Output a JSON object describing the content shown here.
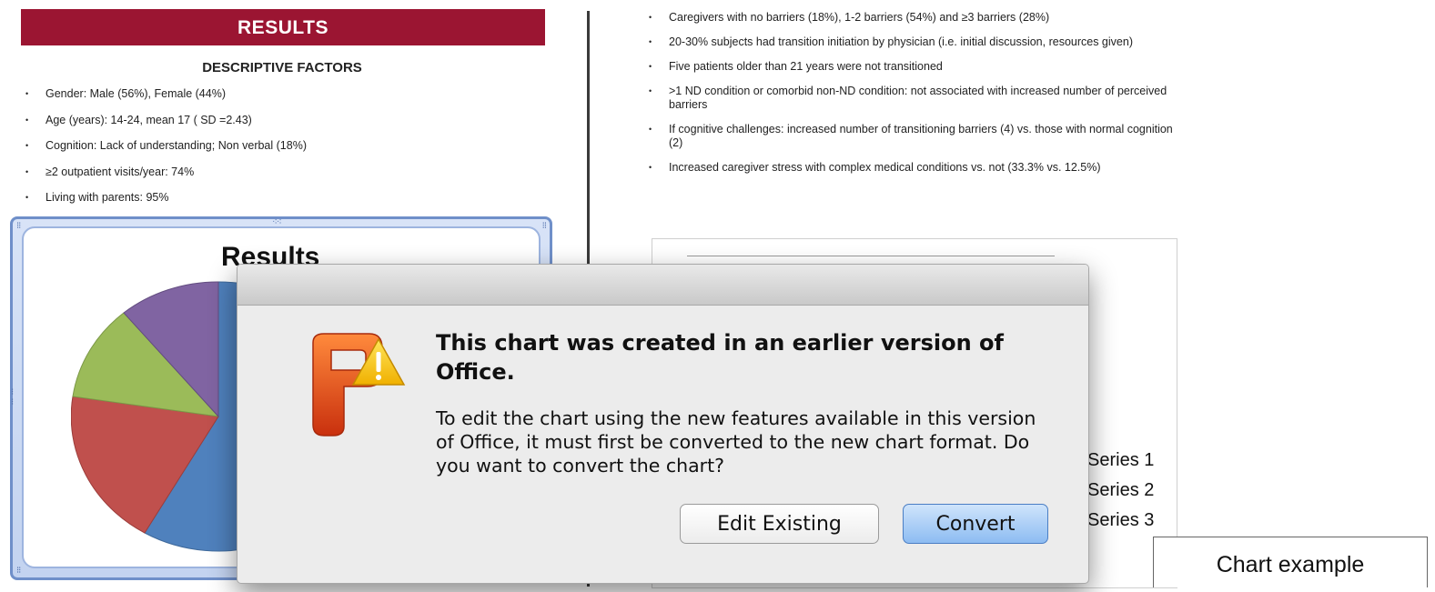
{
  "left": {
    "banner": "RESULTS",
    "subhead": "DESCRIPTIVE FACTORS",
    "bullets": [
      "Gender: Male (56%), Female (44%)",
      "Age (years): 14-24, mean 17 ( SD =2.43)",
      "Cognition: Lack of understanding; Non verbal (18%)",
      "≥2 outpatient visits/year: 74%",
      "Living with parents: 95%"
    ],
    "chart": {
      "title": "Results"
    }
  },
  "right": {
    "bullets": [
      "Caregivers with no barriers (18%), 1-2 barriers (54%) and ≥3 barriers (28%)",
      "20-30% subjects had transition initiation by physician (i.e. initial discussion, resources given)",
      "Five patients older than 21 years were not transitioned",
      ">1 ND condition or comorbid non-ND condition: not associated with increased number of perceived barriers",
      "If cognitive challenges: increased number of transitioning barriers (4) vs. those with normal cognition (2)",
      "Increased caregiver stress with complex medical conditions vs. not (33.3% vs. 12.5%)"
    ],
    "legend": [
      "Series 1",
      "Series 2",
      "Series 3"
    ],
    "caption": "Chart example"
  },
  "dialog": {
    "heading": "This chart was created in an earlier version of Office.",
    "body": "To edit the chart using the new features available in this version of Office, it must first be converted to the new chart format. Do you want to convert the chart?",
    "edit_label": "Edit Existing",
    "convert_label": "Convert"
  },
  "colors": {
    "banner": "#9b1532",
    "accent": "#4a7ec4"
  },
  "icons": {
    "app": "powerpoint-icon",
    "warning": "warning-icon"
  }
}
